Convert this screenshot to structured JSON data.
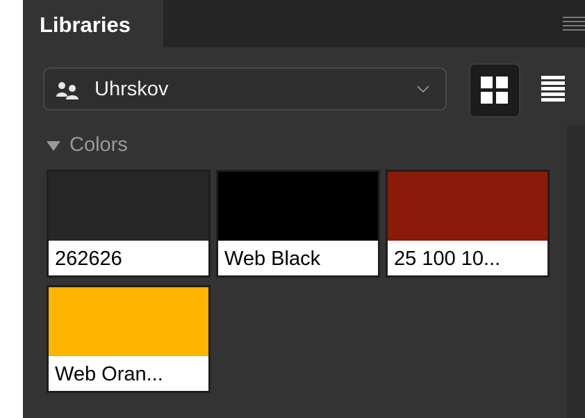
{
  "panel": {
    "tab_label": "Libraries"
  },
  "library_selector": {
    "selected": "Uhrskov",
    "icon": "shared-library-icon"
  },
  "view_toggle": {
    "grid_icon": "grid-view-icon",
    "list_icon": "list-view-icon",
    "active": "grid"
  },
  "section": {
    "label": "Colors",
    "expanded": true
  },
  "swatches": [
    {
      "name": "262626",
      "color": "#262626"
    },
    {
      "name": "Web Black",
      "color": "#000000"
    },
    {
      "name": "25 100 10...",
      "color": "#8b1a0b"
    },
    {
      "name": "Web Oran...",
      "color": "#ffb400"
    }
  ]
}
